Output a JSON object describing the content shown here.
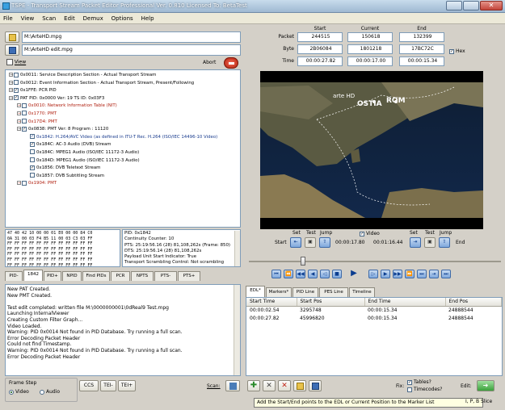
{
  "window": {
    "title": "TSPE - Transport Stream Packet Editor Professional Ver. 0.810 Licensed To: BetaTest"
  },
  "menu": [
    "File",
    "View",
    "Scan",
    "Edit",
    "Demux",
    "Options",
    "Help"
  ],
  "files": {
    "input_path": "M:\\ArteHD.mpg",
    "output_path": "M:\\ArteHD edit.mpg",
    "view_label": "View",
    "abort_label": "Abort"
  },
  "tree": [
    {
      "text": "0x0011: Service Description Section - Actual Transport Stream",
      "color": "normal",
      "check": "",
      "level": 0
    },
    {
      "text": "0x0012: Event Information Section - Actual Transport Stream, Present/Following",
      "color": "normal",
      "check": "",
      "level": 0
    },
    {
      "text": "0x1FFE: PCR PID",
      "color": "normal",
      "check": "checked",
      "level": 0
    },
    {
      "text": "PAT PID: 0x0000 Ver: 19 TS ID: 0x03F3",
      "color": "normal",
      "check": "checked",
      "level": 0
    },
    {
      "text": "0x0010: Network Information Table (NIT)",
      "color": "red",
      "check": "",
      "level": 1
    },
    {
      "text": "0x1770: PMT",
      "color": "red",
      "check": "",
      "level": 1
    },
    {
      "text": "0x17D4: PMT",
      "color": "red",
      "check": "",
      "level": 1
    },
    {
      "text": "0x0838: PMT Ver: 8 Program : 11120",
      "color": "normal",
      "check": "checked",
      "level": 1
    },
    {
      "text": "0x1842: H.264/AVC Video (as defined in ITU-T Rec. H.264 (ISO/IEC 14496-10 Video)",
      "color": "blue",
      "check": "checked",
      "level": 2
    },
    {
      "text": "0x184C: AC-3 Audio (DVB) Stream",
      "color": "normal",
      "check": "checked",
      "level": 2
    },
    {
      "text": "0x184C: MPEG1 Audio (ISO/IEC 11172-3 Audio)",
      "color": "normal",
      "check": "",
      "level": 2
    },
    {
      "text": "0x184D: MPEG1 Audio (ISO/IEC 11172-3 Audio)",
      "color": "normal",
      "check": "",
      "level": 2
    },
    {
      "text": "0x1856: DVB Teletext Stream",
      "color": "normal",
      "check": "checked",
      "level": 2
    },
    {
      "text": "0x1857: DVB Subtitling Stream",
      "color": "normal",
      "check": "",
      "level": 2
    },
    {
      "text": "0x1904: PMT",
      "color": "red",
      "check": "",
      "level": 1
    }
  ],
  "hex": [
    "47 40 42 10 00 00 01 E0 00 00 84 C0",
    "0A 31 00 03 F4 B5 11 00 03 C3 03 FF",
    "FF FF FF FF FF FF FF FF FF FF FF FF",
    "FF FF FF FF FF FF FF FF FF FF FF FF",
    "FF FF FF FF FF FF FF FF FF FF FF FF",
    "FF FF FF FF FF FF FF FF FF FF FF FF",
    "FF FF FF FF FF FF FF FF FF FF FF FF"
  ],
  "packet_info": [
    "PID: 0x1842",
    "Continuity Counter: 10",
    "PTS: 25:19:56.16 (28)  81,108,262s (Frame: 850)",
    "DTS: 25:19:56.14 (28)  81,108,262s",
    "Payload Unit Start Indicator: True",
    "Transport Scrambling Control: Not scrambling"
  ],
  "pid_tabs": [
    "PID-",
    "1842",
    "PID+",
    "NPID",
    "Find PIDs",
    "PCR",
    "NPTS",
    "PTS-",
    "PTS+"
  ],
  "log": [
    "New PAT Created.",
    "New PMT Created.",
    "",
    "Test edit completed: written file M:\\0000000001\\0dReal9 Test.mpg",
    "Launching InternalViewer",
    "Creating Custom Filter Graph...",
    "Video Loaded.",
    "Warning: PID 0x0014 Not found in PID Database.  Try running a full scan.",
    "Error Decoding Packet Header",
    "Could not find Timestamp.",
    "Warning: PID 0x0014 Not found in PID Database.  Try running a full scan.",
    "Error Decoding Packet Header"
  ],
  "frame_step": {
    "label": "Frame Step",
    "video": "Video",
    "audio": "Audio",
    "buttons": [
      "CCS",
      "TEI-",
      "TEI+"
    ],
    "scan_label": "Scan:"
  },
  "positions": {
    "headers": [
      "Start",
      "Current",
      "End"
    ],
    "rows": [
      {
        "label": "Packet",
        "values": [
          "244515",
          "150618",
          "132399"
        ]
      },
      {
        "label": "Byte",
        "values": [
          "2B06084",
          "1801218",
          "17BC72C"
        ]
      },
      {
        "label": "Time",
        "values": [
          "00:00:27.82",
          "00:00:17.00",
          "00:00:15.34"
        ]
      }
    ],
    "hex_label": "Hex"
  },
  "video_overlay": {
    "logo": "arte HD",
    "city1": "OSTIA",
    "city2": "ROM"
  },
  "markers": {
    "set": "Set",
    "test": "Test",
    "jump": "Jump",
    "start": "Start",
    "end": "End",
    "time1": "00:00:17.80",
    "time2": "00:01:16.44",
    "video_label": "Video"
  },
  "edl": {
    "tabs": [
      "EDL*",
      "Markers*",
      "PID Line",
      "PES Line",
      "Timeline"
    ],
    "columns": [
      "Start Time",
      "Start Pos",
      "End Time",
      "End Pos"
    ],
    "rows": [
      [
        "00:00:02.54",
        "3295748",
        "00:00:15.34",
        "24888544"
      ],
      [
        "00:00:27.82",
        "45996820",
        "00:00:15.34",
        "24888544"
      ]
    ],
    "fix_label": "Fix:",
    "tables_label": "Tables?",
    "timecodes_label": "Timecodes?",
    "edit_label": "Edit:"
  },
  "tooltip": "Add the Start/End points to the EDL or Current Position to the Marker List",
  "slice_label": "I, P, B Slice"
}
